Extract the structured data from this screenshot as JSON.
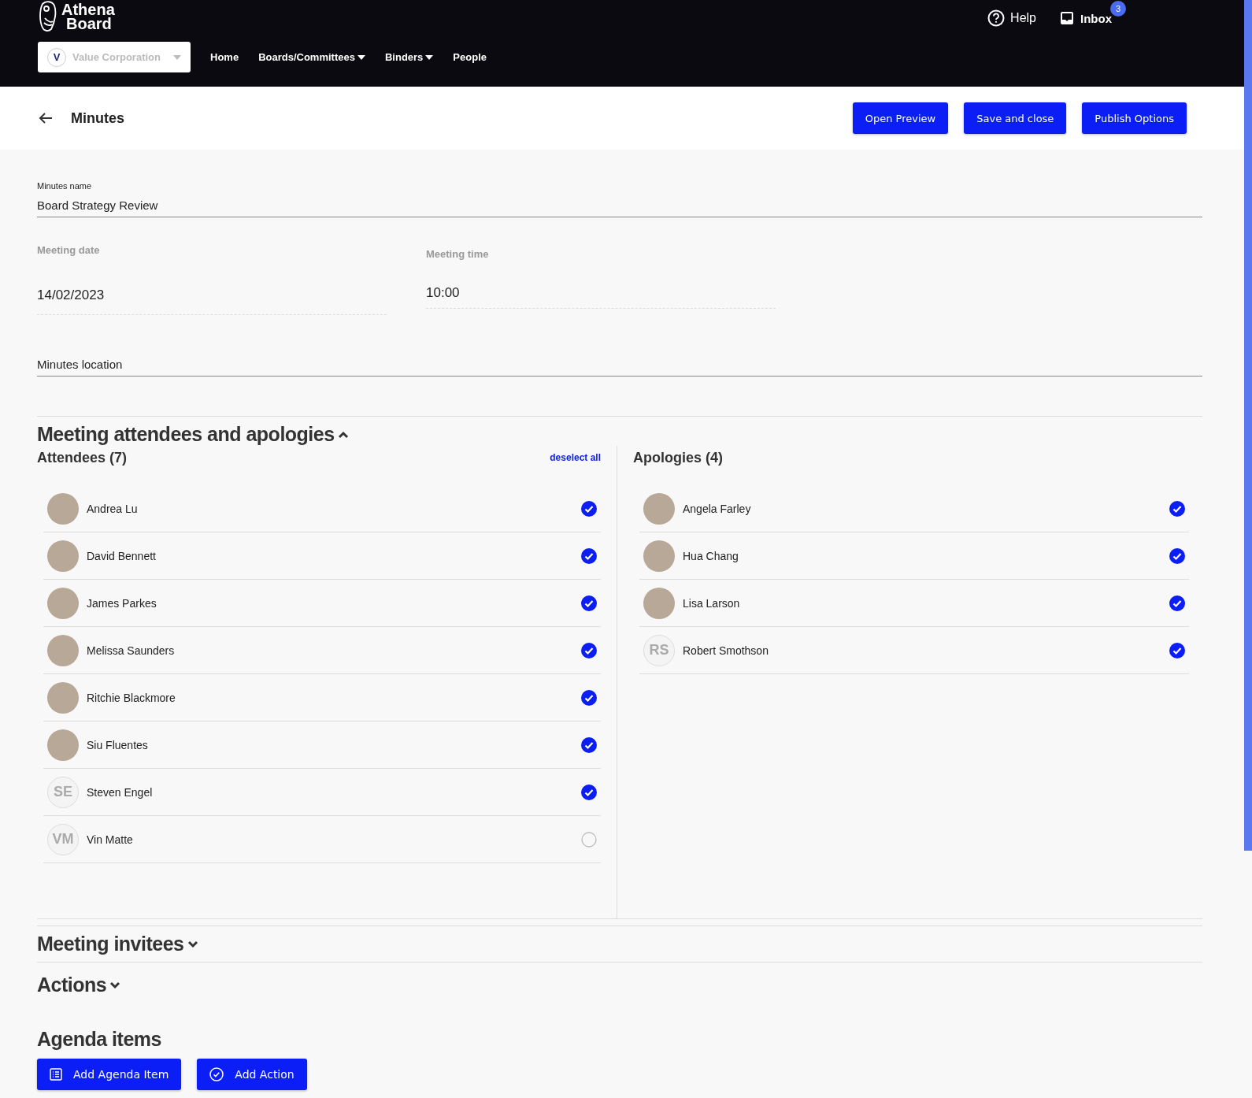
{
  "brand": {
    "line1": "Athena",
    "line2": "Board"
  },
  "org_select": {
    "label": "Value Corporation",
    "logo": "V"
  },
  "nav": [
    {
      "label": "Home",
      "dropdown": false
    },
    {
      "label": "Boards/Committees",
      "dropdown": true
    },
    {
      "label": "Binders",
      "dropdown": true
    },
    {
      "label": "People",
      "dropdown": false
    }
  ],
  "top_links": {
    "help": "Help",
    "inbox": "Inbox",
    "inbox_badge": "3"
  },
  "page": {
    "title": "Minutes",
    "buttons": [
      "Open Preview",
      "Save and close",
      "Publish Options"
    ]
  },
  "form": {
    "name_label": "Minutes name",
    "name_value": "Board Strategy Review",
    "date_label": "Meeting date",
    "date_value": "14/02/2023",
    "time_label": "Meeting time",
    "time_value": "10:00",
    "location_placeholder": "Minutes location"
  },
  "attendance": {
    "title": "Meeting attendees and apologies",
    "expanded": true,
    "attendees_title": "Attendees (7)",
    "deselect_all": "deselect all",
    "attendees": [
      {
        "name": "Andrea Lu",
        "kind": "photo",
        "checked": true
      },
      {
        "name": "David Bennett",
        "kind": "photo",
        "checked": true
      },
      {
        "name": "James Parkes",
        "kind": "photo",
        "checked": true
      },
      {
        "name": "Melissa Saunders",
        "kind": "photo",
        "checked": true
      },
      {
        "name": "Ritchie Blackmore",
        "kind": "photo",
        "checked": true
      },
      {
        "name": "Siu Fluentes",
        "kind": "photo",
        "checked": true
      },
      {
        "name": "Steven Engel",
        "kind": "initials",
        "initials": "SE",
        "checked": true
      },
      {
        "name": "Vin Matte",
        "kind": "initials",
        "initials": "VM",
        "checked": false
      }
    ],
    "apologies_title": "Apologies (4)",
    "apologies": [
      {
        "name": "Angela Farley",
        "kind": "photo",
        "checked": true
      },
      {
        "name": "Hua Chang",
        "kind": "photo",
        "checked": true
      },
      {
        "name": "Lisa Larson",
        "kind": "photo",
        "checked": true
      },
      {
        "name": "Robert Smothson",
        "kind": "initials",
        "initials": "RS",
        "checked": true
      }
    ]
  },
  "sections": [
    {
      "title": "Meeting invitees",
      "expanded": false
    },
    {
      "title": "Actions",
      "expanded": false
    }
  ],
  "agenda": {
    "title": "Agenda items",
    "buttons": [
      {
        "label": "Add Agenda Item",
        "kind": "list"
      },
      {
        "label": "Add Action",
        "kind": "check"
      }
    ]
  }
}
